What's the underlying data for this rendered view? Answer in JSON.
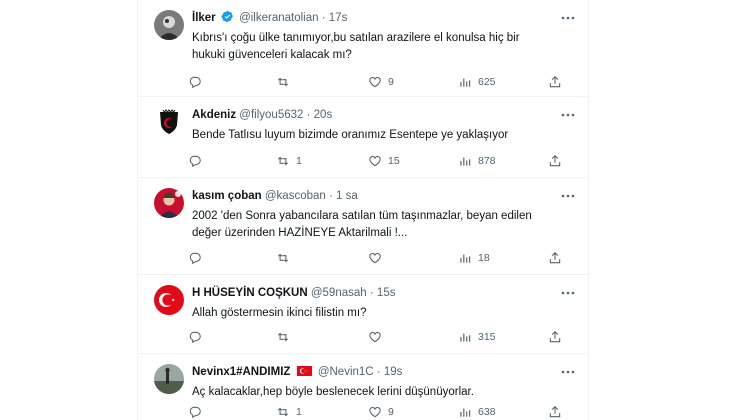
{
  "tweets": [
    {
      "name": "İlker",
      "verified": true,
      "handle": "@ilkeranatolian",
      "dot": "·",
      "time": "17s",
      "text": "Kıbrıs'ı çoğu ülke tanımıyor,bu satılan arazilere el konulsa hiç bir hukuki güvenceleri kalacak mı?",
      "reply_count": "",
      "retweet_count": "",
      "like_count": "9",
      "view_count": "625",
      "avatar": {
        "type": "photo",
        "color": "#6b6b6b"
      }
    },
    {
      "name": "Akdeniz",
      "verified": false,
      "handle": "@filyou5632",
      "dot": "·",
      "time": "20s",
      "text": "Bende Tatlısu luyum bizimde oranımız Esentepe ye yaklaşıyor",
      "reply_count": "",
      "retweet_count": "1",
      "like_count": "15",
      "view_count": "878",
      "avatar": {
        "type": "crest",
        "color": "#111111"
      }
    },
    {
      "name": "kasım çoban",
      "verified": false,
      "handle": "@kascoban",
      "dot": "·",
      "time": "1 sa",
      "text": "2002 'den  Sonra yabancılara satılan tüm taşınmazlar, beyan edilen değer üzerinden HAZİNEYE Aktarilmali !...",
      "reply_count": "",
      "retweet_count": "",
      "like_count": "",
      "view_count": "18",
      "avatar": {
        "type": "portrait",
        "color": "#c8102e"
      }
    },
    {
      "name": "H HÜSEYİN COŞKUN",
      "verified": false,
      "handle": "@59nasah",
      "dot": "·",
      "time": "15s",
      "text": "Allah göstermesin ikinci filistin mı?",
      "reply_count": "",
      "retweet_count": "",
      "like_count": "",
      "view_count": "315",
      "avatar": {
        "type": "flag",
        "color": "#e30a17"
      }
    },
    {
      "name": "Nevinx1#ANDIMIZ",
      "flag_after_name": true,
      "verified": false,
      "handle": "@Nevin1C",
      "dot": "·",
      "time": "19s",
      "text": "Aç kalacaklar,hep böyle beslenecek lerini düşünüyorlar.",
      "reply_count": "",
      "retweet_count": "1",
      "like_count": "9",
      "view_count": "638",
      "avatar": {
        "type": "landscape",
        "color": "#5a6b5a"
      }
    }
  ],
  "colors": {
    "text": "#0f1419",
    "secondary": "#536471",
    "border": "#eff3f4",
    "verified": "#1d9bf0",
    "turkish_red": "#e30a17"
  },
  "icons": [
    "reply-icon",
    "retweet-icon",
    "like-icon",
    "views-icon",
    "share-icon",
    "more-icon",
    "verified-icon"
  ]
}
